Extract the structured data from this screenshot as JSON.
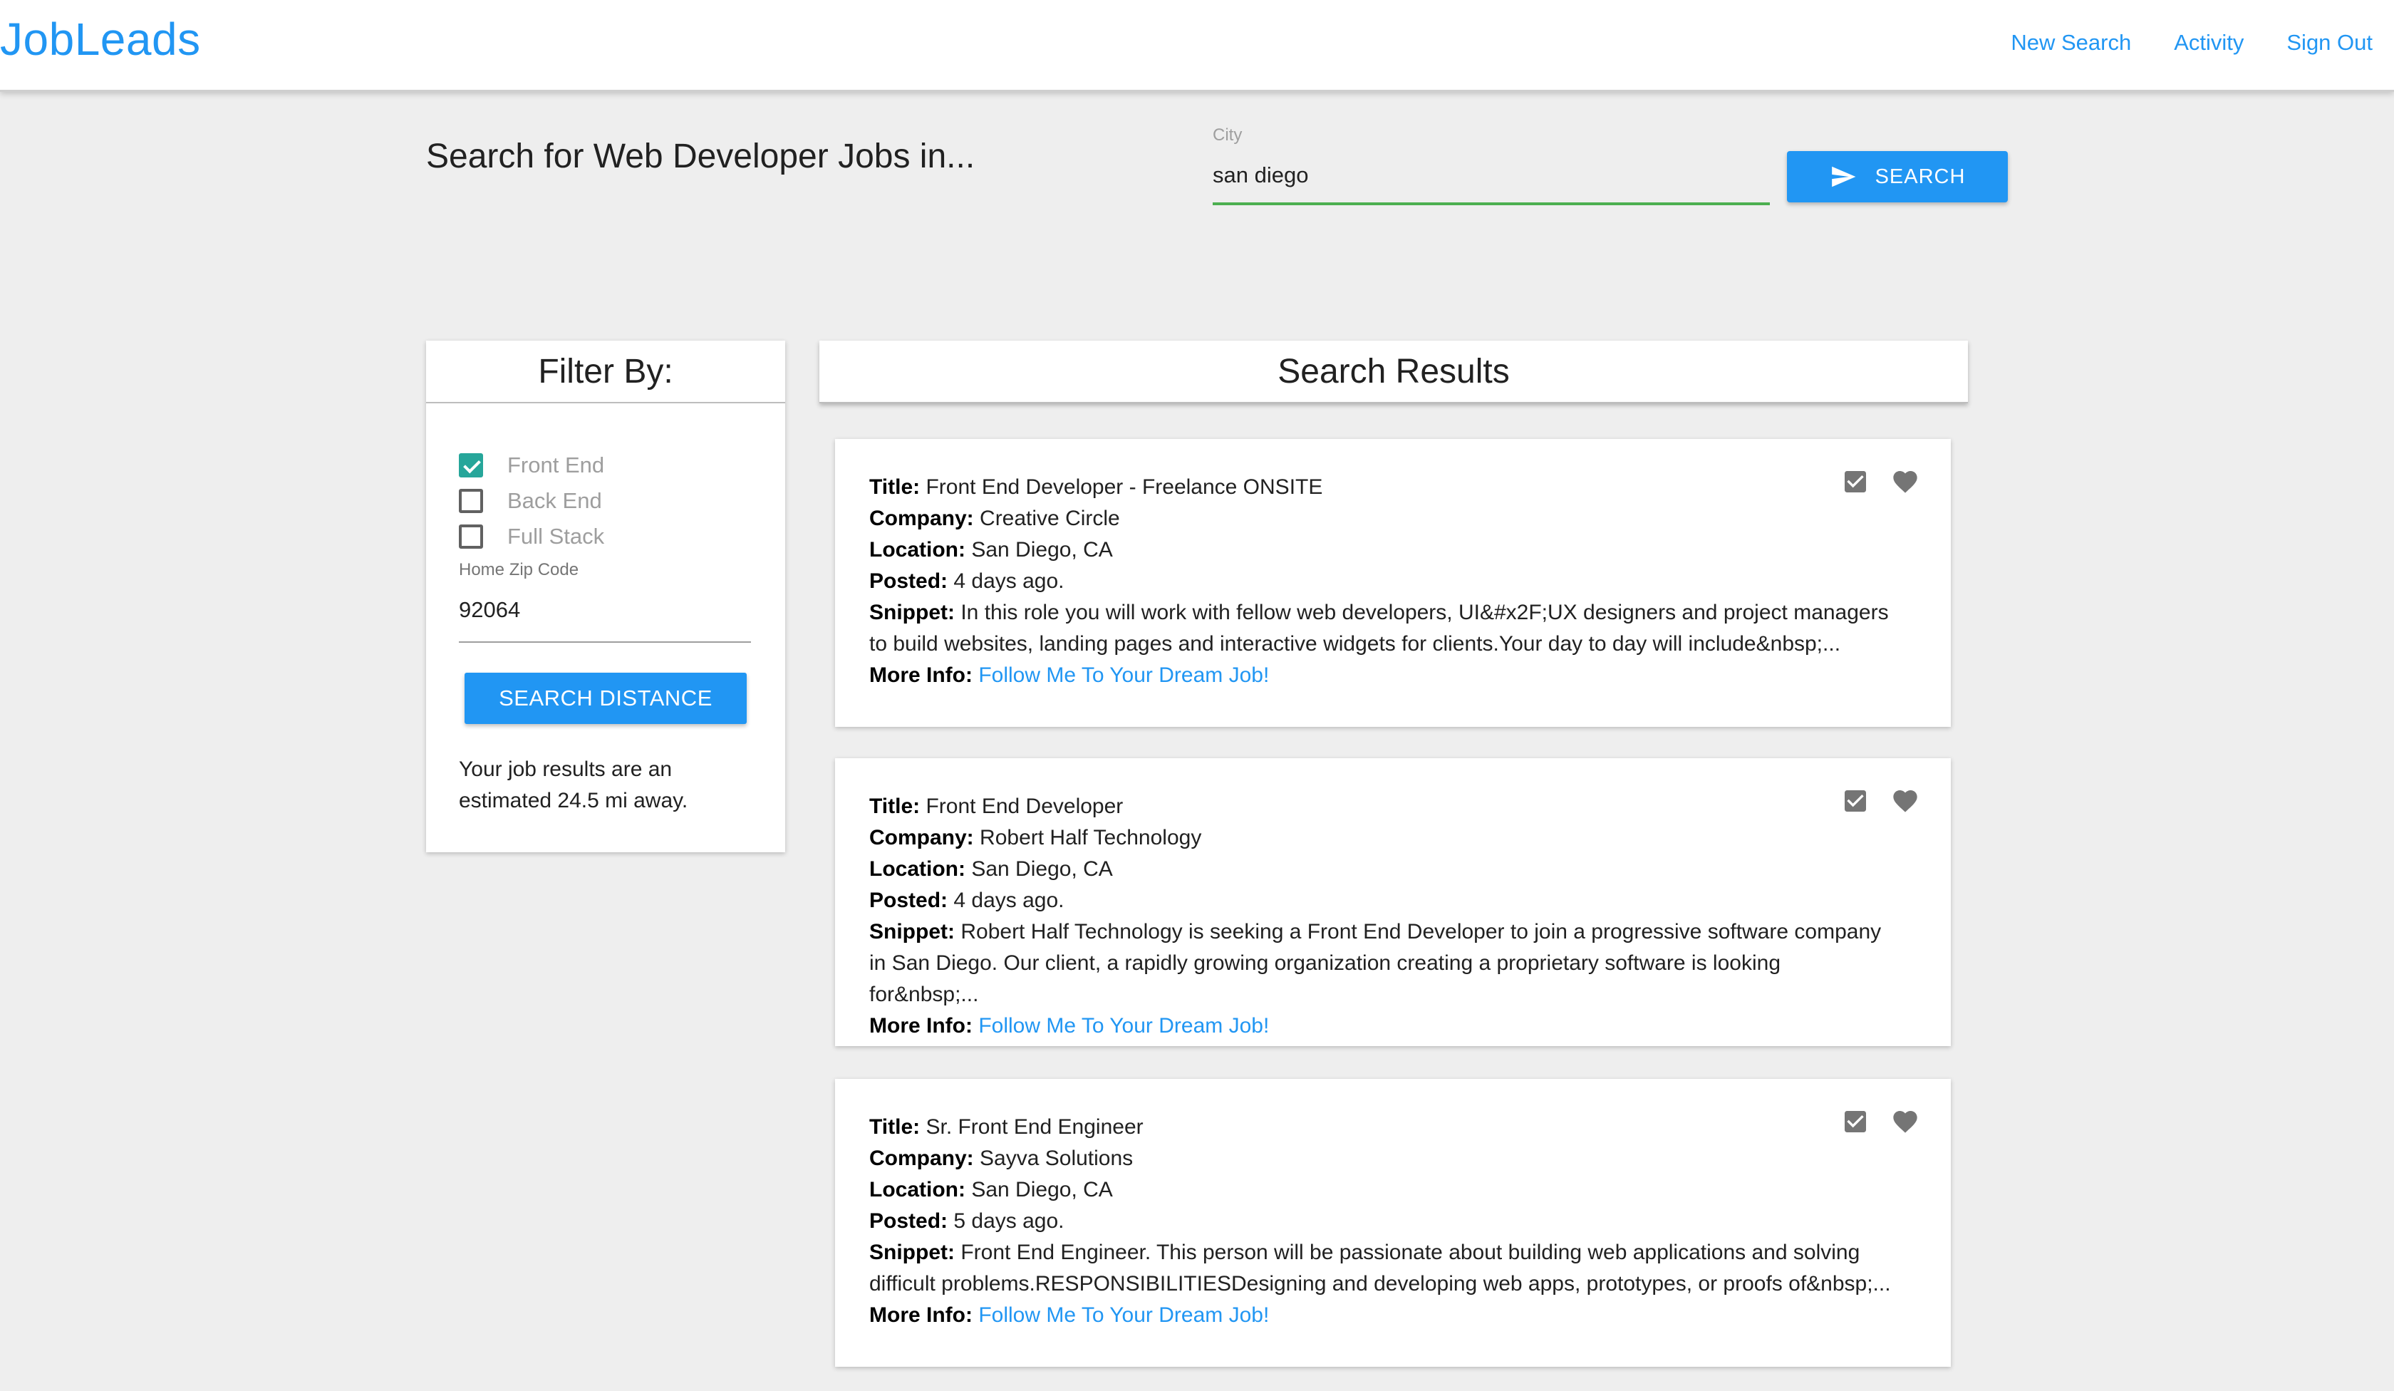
{
  "nav": {
    "brand": "JobLeads",
    "links": [
      "New Search",
      "Activity",
      "Sign Out"
    ]
  },
  "search": {
    "heading": "Search for Web Developer Jobs in...",
    "city_label": "City",
    "city_value": "san diego",
    "button_label": "SEARCH"
  },
  "filter": {
    "title": "Filter By:",
    "options": [
      {
        "label": "Front End",
        "checked": true
      },
      {
        "label": "Back End",
        "checked": false
      },
      {
        "label": "Full Stack",
        "checked": false
      }
    ],
    "zip_label": "Home Zip Code",
    "zip_value": "92064",
    "distance_button": "SEARCH DISTANCE",
    "distance_note": "Your job results are an estimated 24.5 mi away."
  },
  "results": {
    "title": "Search Results",
    "field_labels": {
      "title": "Title:",
      "company": "Company:",
      "location": "Location:",
      "posted": "Posted:",
      "snippet": "Snippet:",
      "more": "More Info:"
    },
    "jobs": [
      {
        "title": "Front End Developer - Freelance ONSITE",
        "company": "Creative Circle",
        "location": "San Diego, CA",
        "posted": "4 days ago.",
        "snippet": "In this role you will work with fellow web developers, UI&#x2F;UX designers and project managers to build websites, landing pages and interactive widgets for clients.Your day to day will include&nbsp;...",
        "link": "Follow Me To Your Dream Job!"
      },
      {
        "title": "Front End Developer",
        "company": "Robert Half Technology",
        "location": "San Diego, CA",
        "posted": "4 days ago.",
        "snippet": "Robert Half Technology is seeking a Front End Developer to join a progressive software company in San Diego. Our client, a rapidly growing organization creating a proprietary software is looking for&nbsp;...",
        "link": "Follow Me To Your Dream Job!"
      },
      {
        "title": "Sr. Front End Engineer",
        "company": "Sayva Solutions",
        "location": "San Diego, CA",
        "posted": "5 days ago.",
        "snippet": "Front End Engineer. This person will be passionate about building web applications and solving difficult problems.RESPONSIBILITIESDesigning and developing web apps, prototypes, or proofs of&nbsp;...",
        "link": "Follow Me To Your Dream Job!"
      }
    ]
  },
  "colors": {
    "accent": "#2196f3",
    "checkbox": "#26a69a",
    "input_focus": "#4caf50",
    "icon": "#757575"
  },
  "icons": [
    "send-icon",
    "checkbox-icon",
    "heart-icon"
  ]
}
